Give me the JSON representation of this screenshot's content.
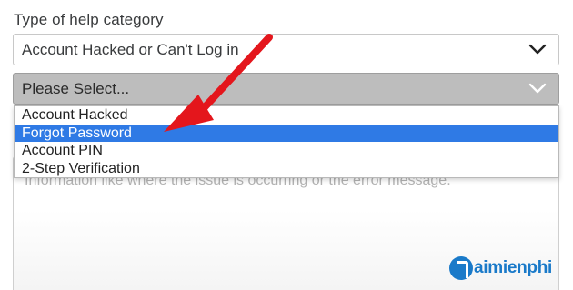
{
  "form": {
    "category_label": "Type of help category",
    "category_value": "Account Hacked or Can't Log in",
    "subcategory_value": "Please Select...",
    "dropdown_options": [
      "Account Hacked",
      "Forgot Password",
      "Account PIN",
      "2-Step Verification"
    ],
    "selected_option": "Forgot Password",
    "description_placeholder": "Information like where the issue is occurring or the error message."
  },
  "watermark": {
    "brand": "Taimienphi",
    "prefix_glyph": "T",
    "text": "aimienphi",
    "tld": ".vn"
  },
  "colors": {
    "selected_option_bg": "#2f7ae5",
    "arrow": "#e4161c",
    "subcategory_bg": "#bdbdbd",
    "watermark": "#1a7ac9"
  },
  "icons": {
    "select_chevron": "chevron-down-icon",
    "annotation": "red-arrow"
  }
}
